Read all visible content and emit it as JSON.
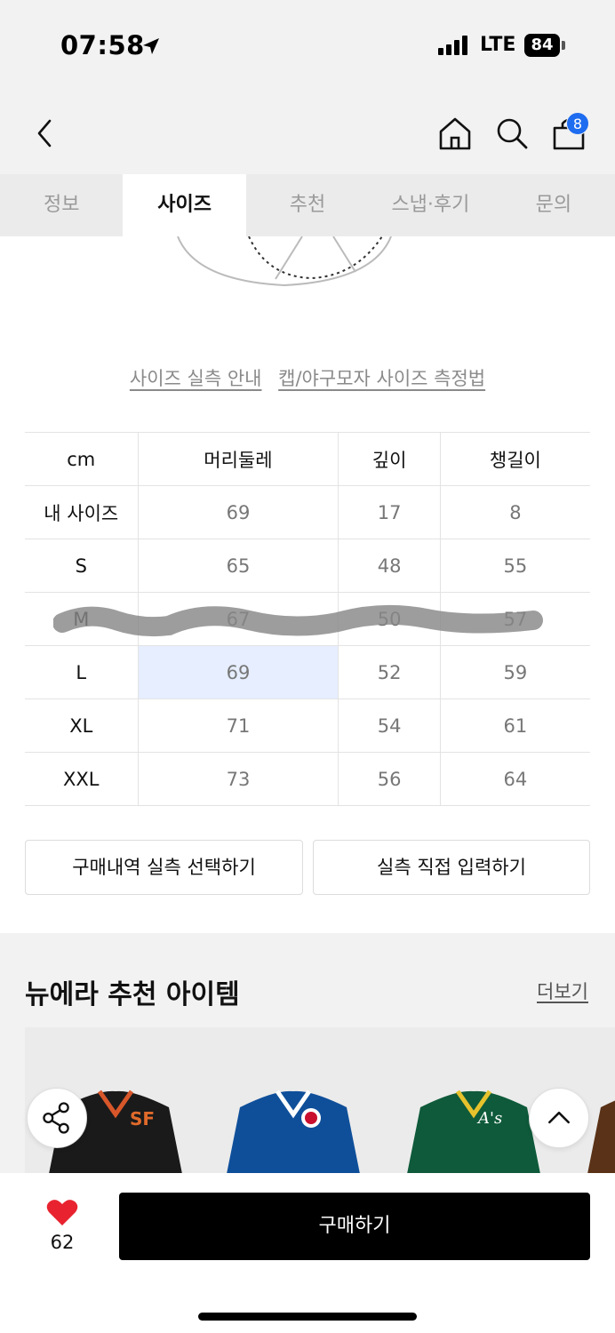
{
  "status_bar": {
    "time": "07:58",
    "network": "LTE",
    "battery": "84"
  },
  "header": {
    "back_icon": "chevron-left-icon",
    "home_icon": "home-icon",
    "search_icon": "search-icon",
    "cart_icon": "shopping-bag-icon",
    "cart_badge": "8"
  },
  "tabs": [
    {
      "label": "정보",
      "active": false
    },
    {
      "label": "사이즈",
      "active": true
    },
    {
      "label": "추천",
      "active": false
    },
    {
      "label": "스냅·후기",
      "active": false
    },
    {
      "label": "문의",
      "active": false
    }
  ],
  "links": {
    "size_guide": "사이즈 실측 안내",
    "measure_guide": "캡/야구모자 사이즈 측정법"
  },
  "size_table": {
    "headers": [
      "cm",
      "머리둘레",
      "깊이",
      "챙길이"
    ],
    "rows": [
      {
        "label": "내 사이즈",
        "values": [
          "69",
          "17",
          "8"
        ]
      },
      {
        "label": "S",
        "values": [
          "65",
          "48",
          "55"
        ]
      },
      {
        "label": "M",
        "values": [
          "67",
          "50",
          "57"
        ]
      },
      {
        "label": "L",
        "values": [
          "69",
          "52",
          "59"
        ]
      },
      {
        "label": "XL",
        "values": [
          "71",
          "54",
          "61"
        ]
      },
      {
        "label": "XXL",
        "values": [
          "73",
          "56",
          "64"
        ]
      }
    ]
  },
  "actions": {
    "select_history": "구매내역 실측 선택하기",
    "direct_input": "실측 직접 입력하기"
  },
  "recommend": {
    "title": "뉴에라 추천 아이템",
    "more": "더보기"
  },
  "bottom_bar": {
    "like_count": "62",
    "buy_label": "구매하기"
  },
  "colors": {
    "accent_blue": "#1e6cf0",
    "highlight_cell": "#e6eeff",
    "like_red": "#e8232f"
  }
}
